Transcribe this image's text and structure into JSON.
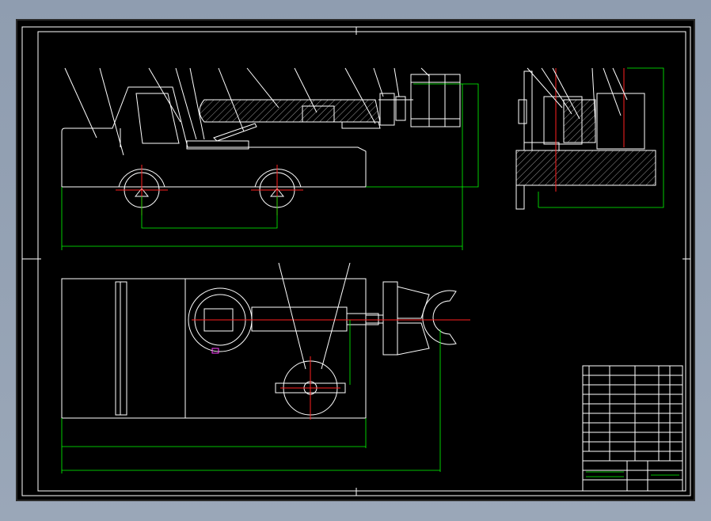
{
  "colors": {
    "background": "#9aa7b8",
    "sheet": "#000000",
    "outline": "#ffffff",
    "dimension": "#00ff00",
    "centerline": "#ff2020",
    "accent": "#ff40ff"
  },
  "drawing": {
    "description_visible_text": false,
    "notes_lines": [
      "",
      "",
      "",
      "",
      "",
      "",
      "",
      "",
      ""
    ]
  }
}
